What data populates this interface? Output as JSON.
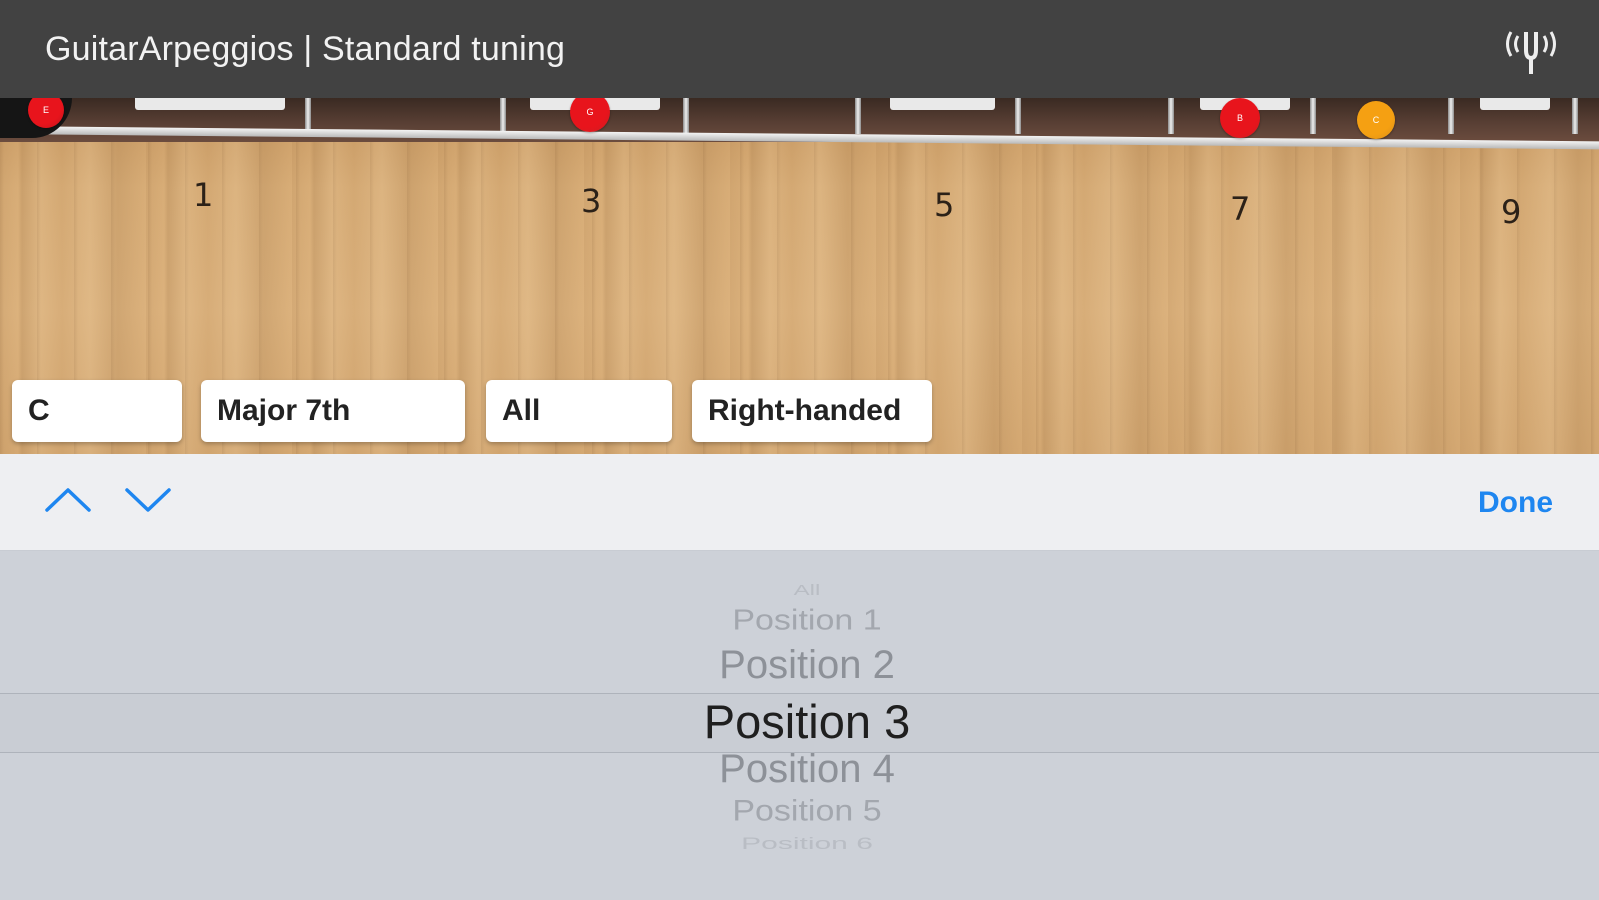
{
  "titlebar": {
    "title": "GuitarArpeggios | Standard tuning",
    "tuner_icon": "tuning-fork-icon"
  },
  "fretboard": {
    "fret_numbers": [
      "1",
      "3",
      "5",
      "7",
      "9"
    ],
    "notes": [
      {
        "label": "E",
        "color": "#e8141c"
      },
      {
        "label": "G",
        "color": "#e8141c"
      },
      {
        "label": "B",
        "color": "#e8141c"
      },
      {
        "label": "C",
        "color": "#f5a012"
      }
    ]
  },
  "selectors": {
    "root": "C",
    "arpeggio": "Major 7th",
    "position": "All",
    "handedness": "Right-handed"
  },
  "toolbar": {
    "up_icon": "chevron-up-icon",
    "down_icon": "chevron-down-icon",
    "done_label": "Done",
    "accent": "#1e86f0"
  },
  "picker": {
    "options": [
      "All",
      "Position 1",
      "Position 2",
      "Position 3",
      "Position 4",
      "Position 5",
      "Position 6"
    ],
    "selected": "Position 3"
  }
}
